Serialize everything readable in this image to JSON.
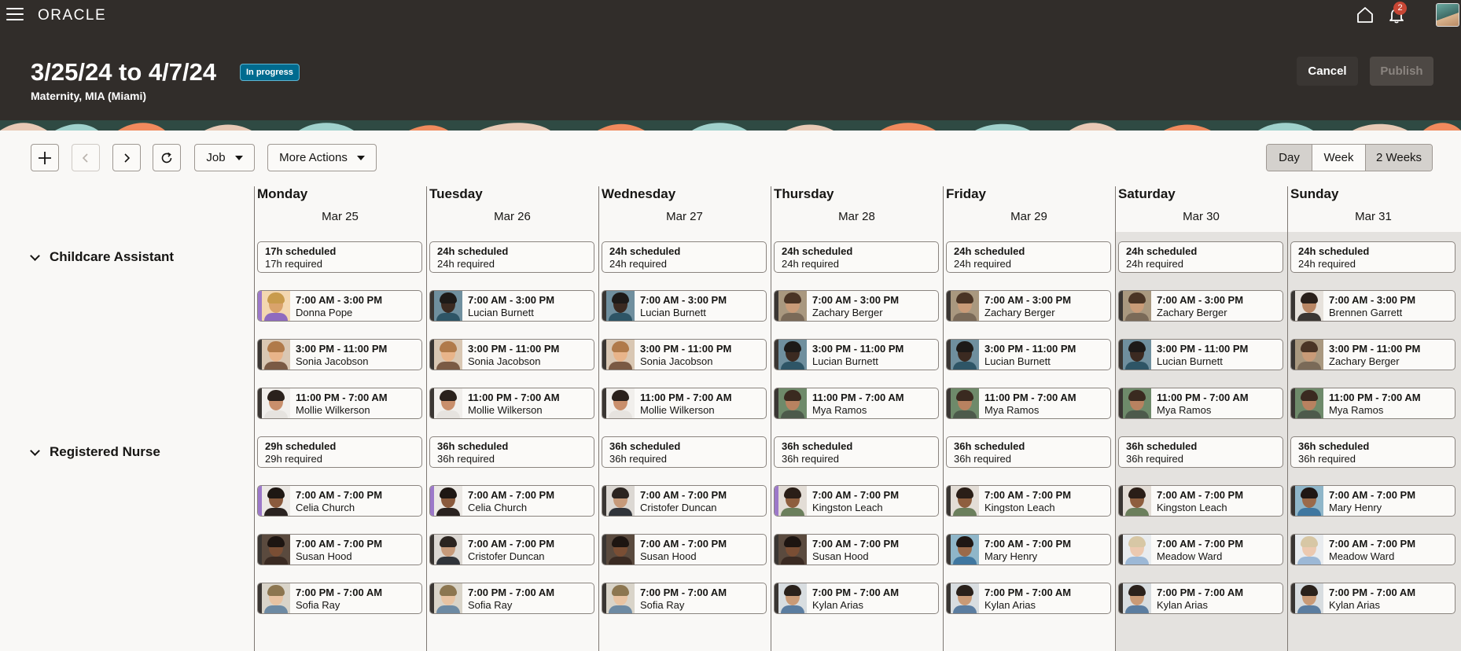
{
  "app": {
    "logo": "ORACLE",
    "notification_count": "2"
  },
  "header": {
    "title": "3/25/24 to 4/7/24",
    "status": "In progress",
    "subtitle": "Maternity, MIA (Miami)",
    "cancel_label": "Cancel",
    "publish_label": "Publish"
  },
  "toolbar": {
    "job_label": "Job",
    "more_actions_label": "More Actions",
    "views": [
      "Day",
      "Week",
      "2 Weeks"
    ],
    "active_view": "2 Weeks"
  },
  "colors": {
    "accent_bar": "#9c78c9",
    "status_badge": "#006b8f"
  },
  "days": [
    {
      "name": "Monday",
      "date": "Mar 25"
    },
    {
      "name": "Tuesday",
      "date": "Mar 26"
    },
    {
      "name": "Wednesday",
      "date": "Mar 27"
    },
    {
      "name": "Thursday",
      "date": "Mar 28"
    },
    {
      "name": "Friday",
      "date": "Mar 29"
    },
    {
      "name": "Saturday",
      "date": "Mar 30"
    },
    {
      "name": "Sunday",
      "date": "Mar 31"
    }
  ],
  "groups": [
    {
      "name": "Childcare Assistant",
      "summaries": [
        {
          "scheduled": "17h scheduled",
          "required": "17h required"
        },
        {
          "scheduled": "24h scheduled",
          "required": "24h required"
        },
        {
          "scheduled": "24h scheduled",
          "required": "24h required"
        },
        {
          "scheduled": "24h scheduled",
          "required": "24h required"
        },
        {
          "scheduled": "24h scheduled",
          "required": "24h required"
        },
        {
          "scheduled": "24h scheduled",
          "required": "24h required"
        },
        {
          "scheduled": "24h scheduled",
          "required": "24h required"
        }
      ],
      "shift_rows": [
        [
          {
            "time": "7:00 AM - 3:00 PM",
            "name": "Donna Pope",
            "accent": true
          },
          {
            "time": "7:00 AM - 3:00 PM",
            "name": "Lucian Burnett"
          },
          {
            "time": "7:00 AM - 3:00 PM",
            "name": "Lucian Burnett"
          },
          {
            "time": "7:00 AM - 3:00 PM",
            "name": "Zachary Berger"
          },
          {
            "time": "7:00 AM - 3:00 PM",
            "name": "Zachary Berger"
          },
          {
            "time": "7:00 AM - 3:00 PM",
            "name": "Zachary Berger"
          },
          {
            "time": "7:00 AM - 3:00 PM",
            "name": "Brennen Garrett"
          }
        ],
        [
          {
            "time": "3:00 PM - 11:00 PM",
            "name": "Sonia Jacobson"
          },
          {
            "time": "3:00 PM - 11:00 PM",
            "name": "Sonia Jacobson"
          },
          {
            "time": "3:00 PM - 11:00 PM",
            "name": "Sonia Jacobson"
          },
          {
            "time": "3:00 PM - 11:00 PM",
            "name": "Lucian Burnett"
          },
          {
            "time": "3:00 PM - 11:00 PM",
            "name": "Lucian Burnett"
          },
          {
            "time": "3:00 PM - 11:00 PM",
            "name": "Lucian Burnett"
          },
          {
            "time": "3:00 PM - 11:00 PM",
            "name": "Zachary Berger"
          }
        ],
        [
          {
            "time": "11:00 PM - 7:00 AM",
            "name": "Mollie Wilkerson"
          },
          {
            "time": "11:00 PM - 7:00 AM",
            "name": "Mollie Wilkerson"
          },
          {
            "time": "11:00 PM - 7:00 AM",
            "name": "Mollie Wilkerson"
          },
          {
            "time": "11:00 PM - 7:00 AM",
            "name": "Mya Ramos"
          },
          {
            "time": "11:00 PM - 7:00 AM",
            "name": "Mya Ramos"
          },
          {
            "time": "11:00 PM - 7:00 AM",
            "name": "Mya Ramos"
          },
          {
            "time": "11:00 PM - 7:00 AM",
            "name": "Mya Ramos"
          }
        ]
      ]
    },
    {
      "name": "Registered Nurse",
      "summaries": [
        {
          "scheduled": "29h scheduled",
          "required": "29h required"
        },
        {
          "scheduled": "36h scheduled",
          "required": "36h required"
        },
        {
          "scheduled": "36h scheduled",
          "required": "36h required"
        },
        {
          "scheduled": "36h scheduled",
          "required": "36h required"
        },
        {
          "scheduled": "36h scheduled",
          "required": "36h required"
        },
        {
          "scheduled": "36h scheduled",
          "required": "36h required"
        },
        {
          "scheduled": "36h scheduled",
          "required": "36h required"
        }
      ],
      "shift_rows": [
        [
          {
            "time": "7:00 AM - 7:00 PM",
            "name": "Celia Church",
            "accent": true
          },
          {
            "time": "7:00 AM - 7:00 PM",
            "name": "Celia Church",
            "accent": true
          },
          {
            "time": "7:00 AM - 7:00 PM",
            "name": "Cristofer Duncan"
          },
          {
            "time": "7:00 AM - 7:00 PM",
            "name": "Kingston Leach",
            "accent": true
          },
          {
            "time": "7:00 AM - 7:00 PM",
            "name": "Kingston Leach"
          },
          {
            "time": "7:00 AM - 7:00 PM",
            "name": "Kingston Leach"
          },
          {
            "time": "7:00 AM - 7:00 PM",
            "name": "Mary Henry"
          }
        ],
        [
          {
            "time": "7:00 AM - 7:00 PM",
            "name": "Susan Hood"
          },
          {
            "time": "7:00 AM - 7:00 PM",
            "name": "Cristofer Duncan"
          },
          {
            "time": "7:00 AM - 7:00 PM",
            "name": "Susan Hood"
          },
          {
            "time": "7:00 AM - 7:00 PM",
            "name": "Susan Hood"
          },
          {
            "time": "7:00 AM - 7:00 PM",
            "name": "Mary Henry"
          },
          {
            "time": "7:00 AM - 7:00 PM",
            "name": "Meadow Ward"
          },
          {
            "time": "7:00 AM - 7:00 PM",
            "name": "Meadow Ward"
          }
        ],
        [
          {
            "time": "7:00 PM - 7:00 AM",
            "name": "Sofia Ray"
          },
          {
            "time": "7:00 PM - 7:00 AM",
            "name": "Sofia Ray"
          },
          {
            "time": "7:00 PM - 7:00 AM",
            "name": "Sofia Ray"
          },
          {
            "time": "7:00 PM - 7:00 AM",
            "name": "Kylan Arias"
          },
          {
            "time": "7:00 PM - 7:00 AM",
            "name": "Kylan Arias"
          },
          {
            "time": "7:00 PM - 7:00 AM",
            "name": "Kylan Arias"
          },
          {
            "time": "7:00 PM - 7:00 AM",
            "name": "Kylan Arias"
          }
        ]
      ]
    }
  ]
}
